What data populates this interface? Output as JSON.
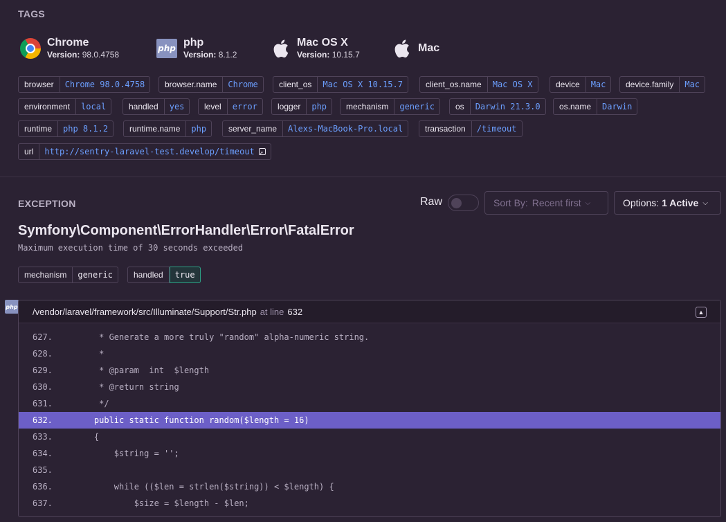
{
  "tags_section": {
    "title": "TAGS"
  },
  "context": [
    {
      "icon": "chrome-logo-icon",
      "name": "Chrome",
      "version_label": "Version:",
      "version": "98.0.4758"
    },
    {
      "icon": "php-logo-icon",
      "icon_text": "php",
      "name": "php",
      "version_label": "Version:",
      "version": "8.1.2"
    },
    {
      "icon": "apple-logo-icon",
      "name": "Mac OS X",
      "version_label": "Version:",
      "version": "10.15.7"
    },
    {
      "icon": "apple-logo-icon",
      "name": "Mac"
    }
  ],
  "tags": [
    {
      "key": "browser",
      "value": "Chrome 98.0.4758"
    },
    {
      "key": "browser.name",
      "value": "Chrome"
    },
    {
      "key": "client_os",
      "value": "Mac OS X 10.15.7"
    },
    {
      "key": "client_os.name",
      "value": "Mac OS X"
    },
    {
      "key": "device",
      "value": "Mac"
    },
    {
      "key": "device.family",
      "value": "Mac"
    },
    {
      "key": "environment",
      "value": "local"
    },
    {
      "key": "handled",
      "value": "yes"
    },
    {
      "key": "level",
      "value": "error"
    },
    {
      "key": "logger",
      "value": "php"
    },
    {
      "key": "mechanism",
      "value": "generic"
    },
    {
      "key": "os",
      "value": "Darwin 21.3.0"
    },
    {
      "key": "os.name",
      "value": "Darwin"
    },
    {
      "key": "runtime",
      "value": "php 8.1.2"
    },
    {
      "key": "runtime.name",
      "value": "php"
    },
    {
      "key": "server_name",
      "value": "Alexs-MacBook-Pro.local"
    },
    {
      "key": "transaction",
      "value": "/timeout"
    },
    {
      "key": "url",
      "value": "http://sentry-laravel-test.develop/timeout"
    }
  ],
  "exception": {
    "title": "EXCEPTION",
    "raw_label": "Raw",
    "sort_label": "Sort By:",
    "sort_value": "Recent first",
    "options_label": "Options:",
    "options_value": "1 Active",
    "type": "Symfony\\Component\\ErrorHandler\\Error\\FatalError",
    "message": "Maximum execution time of 30 seconds exceeded",
    "mechanism": {
      "key": "mechanism",
      "value": "generic"
    },
    "handled": {
      "key": "handled",
      "value": "true"
    }
  },
  "frame": {
    "platform": "php",
    "file": "/vendor/laravel/framework/src/Illuminate/Support/Str.php",
    "at_line_label": "at line",
    "line": "632",
    "lines": [
      {
        "no": "627.",
        "code": "     * Generate a more truly \"random\" alpha-numeric string."
      },
      {
        "no": "628.",
        "code": "     *"
      },
      {
        "no": "629.",
        "code": "     * @param  int  $length"
      },
      {
        "no": "630.",
        "code": "     * @return string"
      },
      {
        "no": "631.",
        "code": "     */"
      },
      {
        "no": "632.",
        "code": "    public static function random($length = 16)"
      },
      {
        "no": "633.",
        "code": "    {"
      },
      {
        "no": "634.",
        "code": "        $string = '';"
      },
      {
        "no": "635.",
        "code": ""
      },
      {
        "no": "636.",
        "code": "        while (($len = strlen($string)) < $length) {"
      },
      {
        "no": "637.",
        "code": "            $size = $length - $len;"
      }
    ]
  }
}
